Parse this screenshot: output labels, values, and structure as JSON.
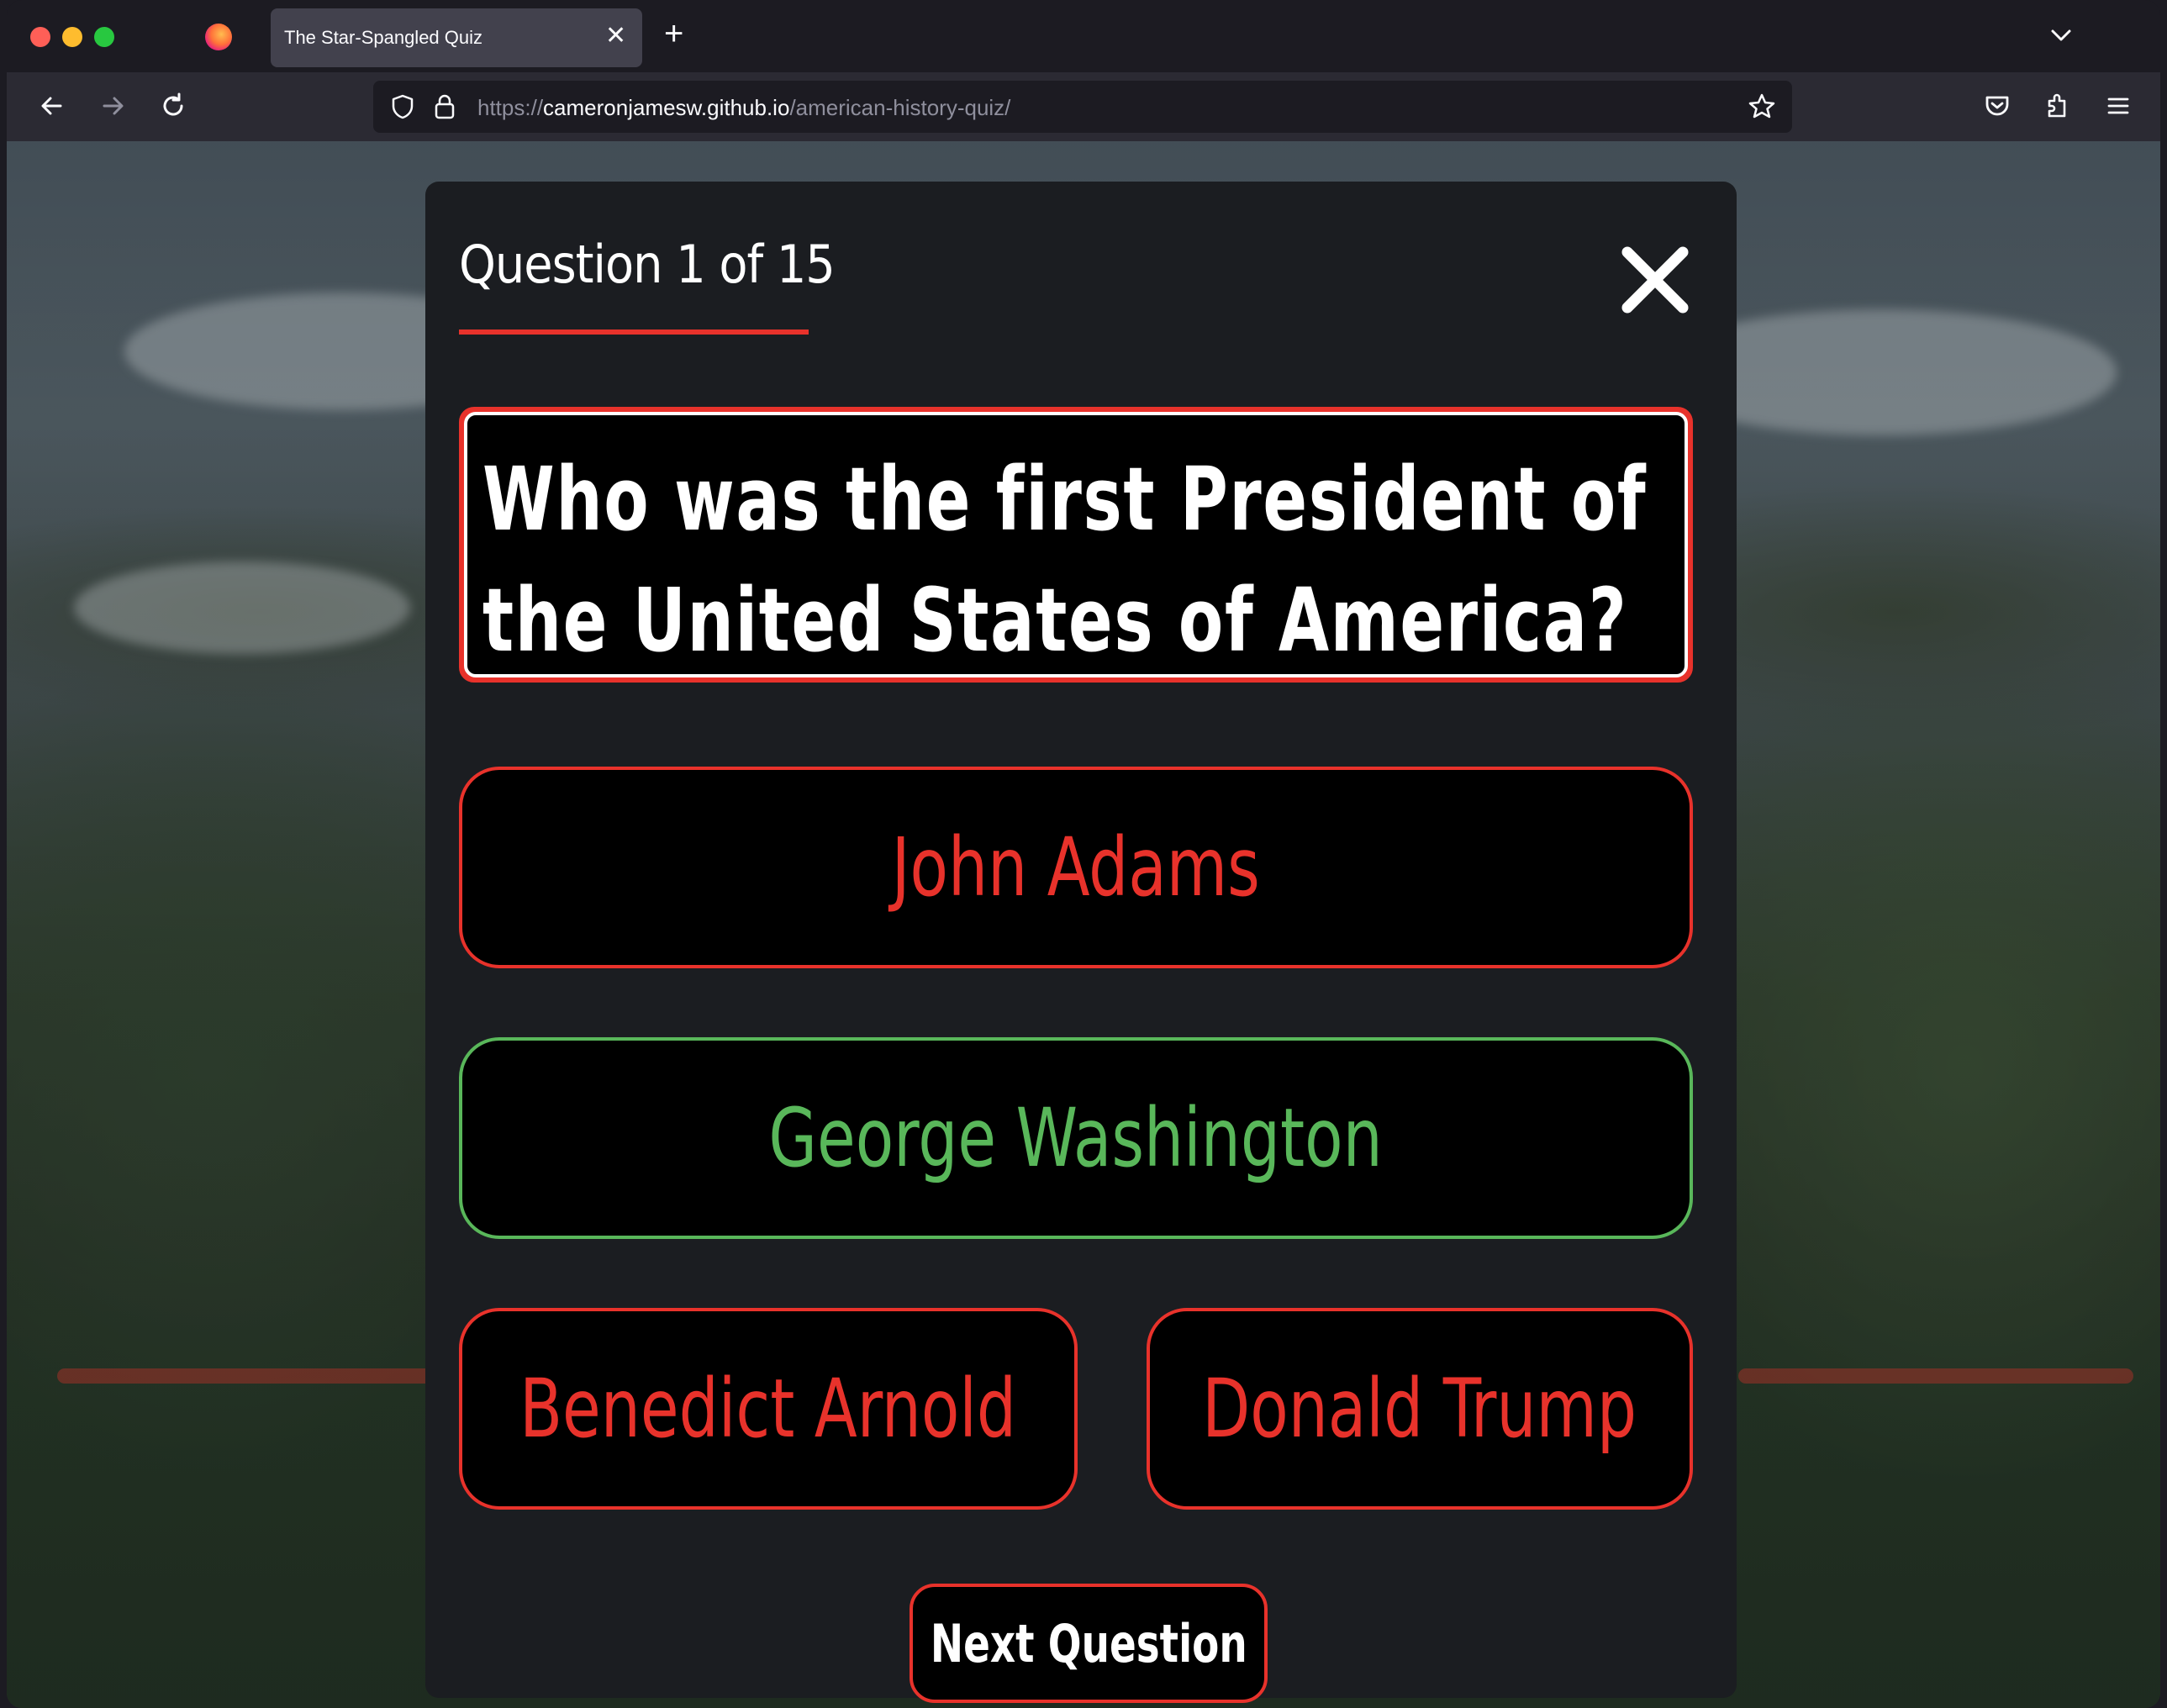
{
  "browser": {
    "tab_title": "The Star-Spangled Quiz",
    "url_scheme": "https://",
    "url_host": "cameronjamesw.github.io",
    "url_path": "/american-history-quiz/"
  },
  "quiz": {
    "counter": "Question 1 of 15",
    "question": "Who was the first President of",
    "question_line2": "the United States of America?",
    "answers": [
      {
        "label": "John Adams",
        "state": "incorrect"
      },
      {
        "label": "George Washington",
        "state": "correct"
      },
      {
        "label": "Benedict Arnold",
        "state": "incorrect"
      },
      {
        "label": "Donald Trump",
        "state": "incorrect"
      }
    ],
    "next_label": "Next Question"
  },
  "colors": {
    "accent_red": "#e8322b",
    "correct_green": "#59b75a",
    "card_bg": "#1b1d21"
  },
  "icons": [
    "firefox-logo-icon",
    "tab-close-icon",
    "new-tab-icon",
    "tab-list-chevron-icon",
    "back-arrow-icon",
    "forward-arrow-icon",
    "reload-icon",
    "shield-icon",
    "lock-icon",
    "bookmark-star-icon",
    "pocket-icon",
    "extensions-icon",
    "menu-icon",
    "close-x-icon"
  ]
}
